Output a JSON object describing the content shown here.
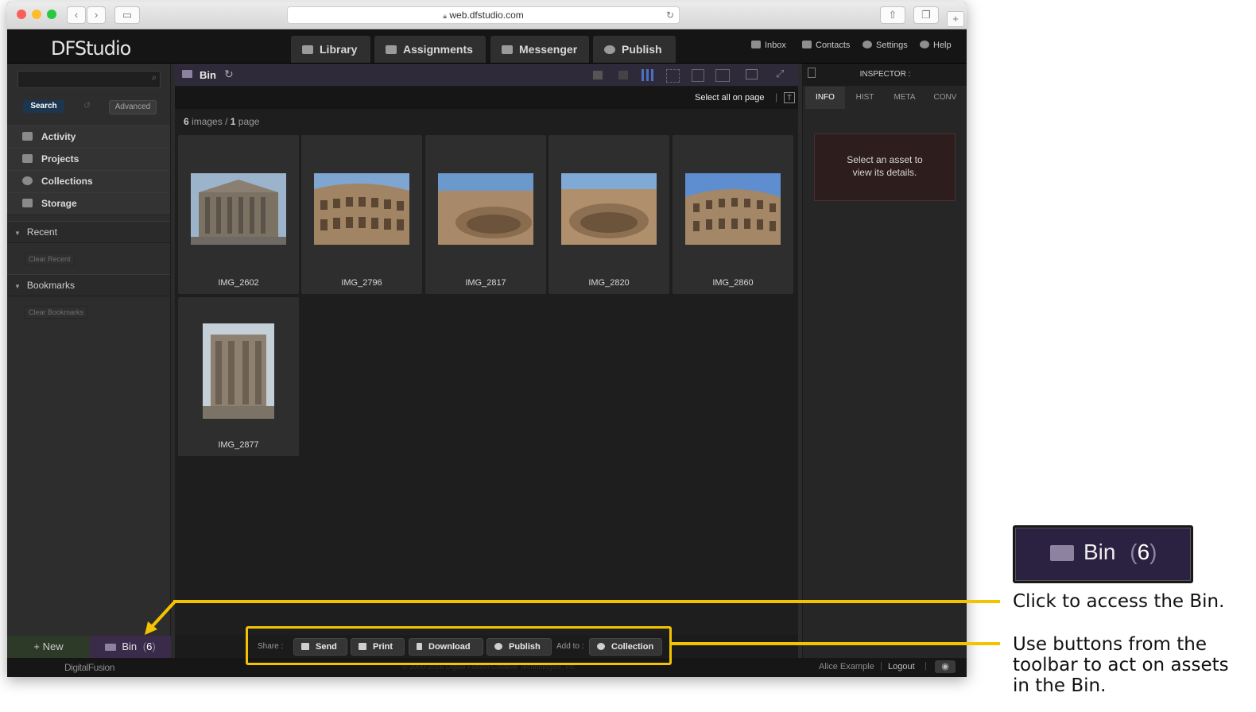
{
  "browser": {
    "url": "web.dfstudio.com"
  },
  "brand": {
    "logo": "DFStudio",
    "footer_logo": "DigitalFusion",
    "copyright": "© 2000-2016 Digital Fusion Creative Technologies, Inc."
  },
  "main_tabs": [
    "Library",
    "Assignments",
    "Messenger",
    "Publish"
  ],
  "top_links": [
    "Inbox",
    "Contacts",
    "Settings",
    "Help"
  ],
  "sidebar": {
    "search_label": "Search",
    "advanced_label": "Advanced",
    "nav": [
      "Activity",
      "Projects",
      "Collections",
      "Storage"
    ],
    "recent": {
      "title": "Recent",
      "clear": "Clear Recent"
    },
    "bookmarks": {
      "title": "Bookmarks",
      "clear": "Clear Bookmarks"
    },
    "new_label": "+ New",
    "bin_label": "Bin",
    "bin_count": "6"
  },
  "center": {
    "title": "Bin",
    "select_all": "Select all on page",
    "count_images": "6",
    "images_word": "images",
    "sep": "/",
    "count_pages": "1",
    "pages_word": "page",
    "images": [
      "IMG_2602",
      "IMG_2796",
      "IMG_2817",
      "IMG_2820",
      "IMG_2860",
      "IMG_2877"
    ]
  },
  "toolbar": {
    "share_label": "Share :",
    "send": "Send",
    "print": "Print",
    "download": "Download",
    "publish": "Publish",
    "add_to_label": "Add to :",
    "collection": "Collection"
  },
  "inspector": {
    "title": "INSPECTOR :",
    "tabs": [
      "INFO",
      "HIST",
      "META",
      "CONV"
    ],
    "empty_line1": "Select an asset to",
    "empty_line2": "view its details."
  },
  "footer": {
    "user": "Alice Example",
    "logout": "Logout"
  },
  "callouts": {
    "zoom_bin": "Bin",
    "zoom_count": "6",
    "note1": "Click to access the Bin.",
    "note2_l1": "Use buttons from the",
    "note2_l2": "toolbar to act on assets",
    "note2_l3": "in the Bin."
  },
  "colors": {
    "callout": "#f3c300",
    "bin_accent": "#3b2b4a"
  }
}
